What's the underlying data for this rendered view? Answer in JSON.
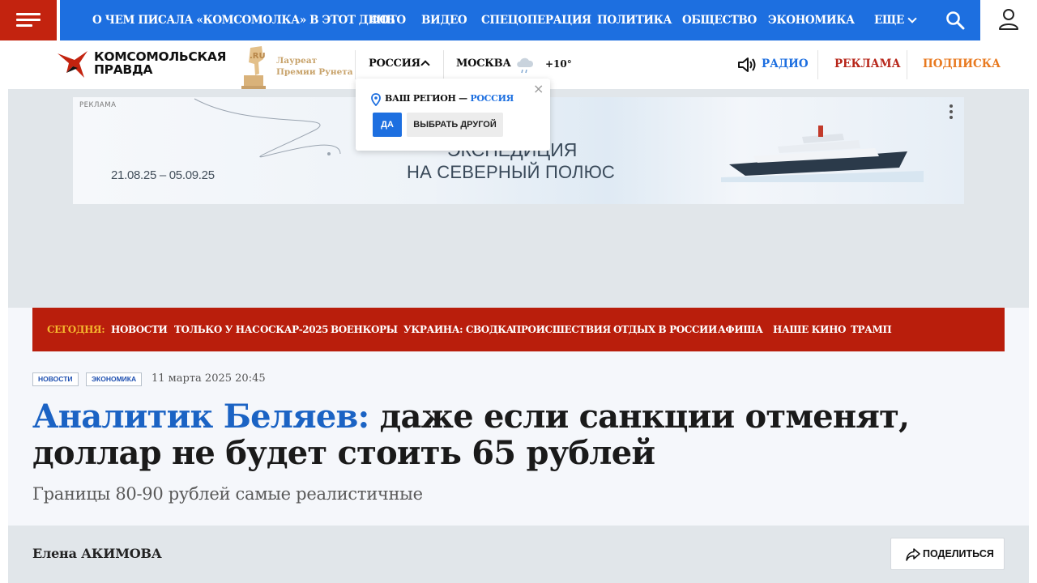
{
  "topnav": {
    "items": [
      "О ЧЕМ ПИСАЛА «КОМСОМОЛКА» В ЭТОТ ДЕНЬ",
      "ФОТО",
      "ВИДЕО",
      "СПЕЦОПЕРАЦИЯ",
      "ПОЛИТИКА",
      "ОБЩЕСТВО",
      "ЭКОНОМИКА"
    ],
    "more_label": "ЕЩЕ"
  },
  "header": {
    "logo_line1": "КОМСОМОЛЬСКАЯ",
    "logo_line2": "ПРАВДА",
    "award_line1": "Лауреат",
    "award_line2": "Премии Рунета",
    "region": "РОССИЯ",
    "city": "МОСКВА",
    "temperature": "+10°",
    "radio": "РАДИО",
    "ads": "РЕКЛАМА",
    "subscribe": "ПОДПИСКА"
  },
  "region_popup": {
    "question_prefix": "ВАШ РЕГИОН —",
    "region": "РОССИЯ",
    "yes_label": "ДА",
    "other_label": "ВЫБРАТЬ ДРУГОЙ",
    "close_glyph": "×"
  },
  "ad_banner": {
    "tag": "РЕКЛАМА",
    "dates": "21.08.25 – 05.09.25",
    "line1": "ЭКСПЕДИЦИЯ",
    "line2": "НА СЕВЕРНЫЙ ПОЛЮС"
  },
  "trending": {
    "label": "СЕГОДНЯ:",
    "items": [
      "НОВОСТИ",
      "ТОЛЬКО У НАС",
      "ОСКАР-2025",
      "ВОЕНКОРЫ",
      "УКРАИНА: СВОДКА",
      "ПРОИСШЕСТВИЯ",
      "ОТДЫХ В РОССИИ",
      "АФИША",
      "НАШЕ КИНО",
      "ТРАМП"
    ]
  },
  "article": {
    "tags": [
      "НОВОСТИ",
      "ЭКОНОМИКА"
    ],
    "date": "11 марта 2025 20:45",
    "title_highlight": "Аналитик Беляев:",
    "title_rest": "даже если санкции отменят, доллар не будет стоить 65 рублей",
    "subtitle": "Границы 80-90 рублей самые реалистичные",
    "author": "Елена АКИМОВА",
    "share_label": "ПОДЕЛИТЬСЯ"
  },
  "colors": {
    "brand_red": "#c3230f",
    "nav_blue": "#1d6fe0",
    "trend_bar": "#b91e0c",
    "title_highlight": "#1b63c4"
  }
}
